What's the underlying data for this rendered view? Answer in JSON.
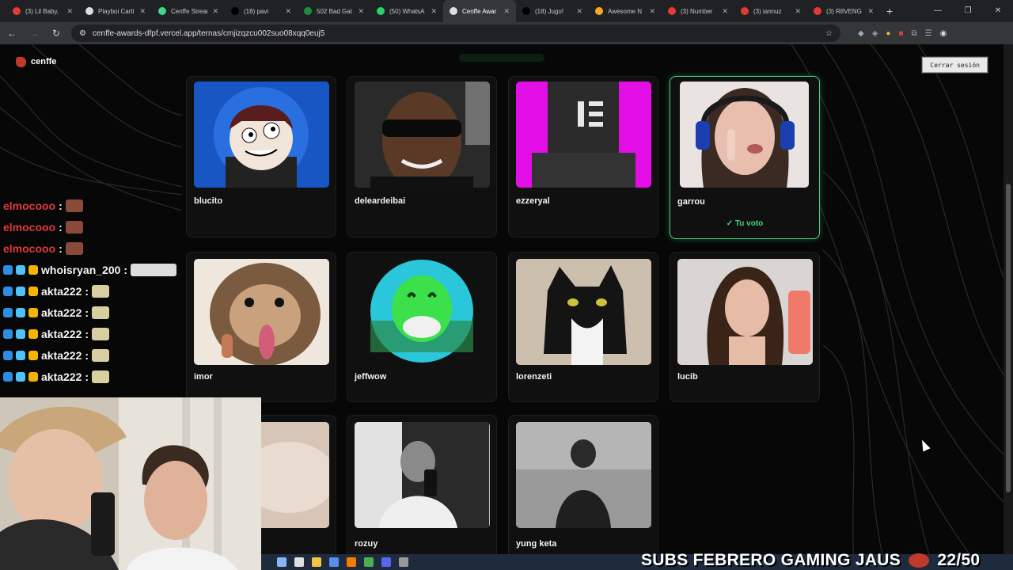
{
  "browser": {
    "tabs": [
      {
        "label": "(3) Lil Baby, ",
        "color": "#e53935"
      },
      {
        "label": "Playboi Carti",
        "color": "#dddddd"
      },
      {
        "label": "Cenffe Stream",
        "color": "#3ddc84"
      },
      {
        "label": "(18) pavi",
        "color": "#000000"
      },
      {
        "label": "502 Bad Gat",
        "color": "#1e8e3e"
      },
      {
        "label": "(50) WhatsA",
        "color": "#25d366"
      },
      {
        "label": "Cenffe Awar",
        "color": "#dddddd"
      },
      {
        "label": "(18) Jugo!",
        "color": "#000000"
      },
      {
        "label": "Awesome N",
        "color": "#f9a825"
      },
      {
        "label": "(3) Number",
        "color": "#e53935"
      },
      {
        "label": "(3) iannuz",
        "color": "#e53935"
      },
      {
        "label": "(3) R8VENG",
        "color": "#e53935"
      }
    ],
    "active_tab_index": 6,
    "new_tab": "+",
    "url": "cenffe-awards-dfpf.vercel.app/ternas/cmjizqzcu002suo08xqq0euj5"
  },
  "site": {
    "logo_text": "cenffe",
    "logout_label": "Cerrar sesión"
  },
  "nominees": [
    {
      "name": "blucito"
    },
    {
      "name": "deleardeibai"
    },
    {
      "name": "ezzeryal"
    },
    {
      "name": "garrou",
      "voted": true
    },
    {
      "name": "imor"
    },
    {
      "name": "jeffwow"
    },
    {
      "name": "lorenzeti"
    },
    {
      "name": "lucib"
    },
    {
      "name": ""
    },
    {
      "name": "rozuy"
    },
    {
      "name": "yung keta"
    }
  ],
  "vote_label": "✓ Tu voto",
  "chat": [
    {
      "user": "elmocooo",
      "color": "red"
    },
    {
      "user": "elmocooo",
      "color": "red"
    },
    {
      "user": "elmocooo",
      "color": "red"
    },
    {
      "user": "whoisryan_200",
      "color": "white"
    },
    {
      "user": "akta222",
      "color": "white"
    },
    {
      "user": "akta222",
      "color": "white"
    },
    {
      "user": "akta222",
      "color": "white"
    },
    {
      "user": "akta222",
      "color": "white"
    },
    {
      "user": "akta222",
      "color": "white"
    }
  ],
  "chat_separator": ":",
  "overlay": {
    "text": "SUBS FEBRERO GAMING JAUS",
    "count": "22/50"
  },
  "colors": {
    "accent": "#46d37a",
    "bg": "#070707"
  }
}
